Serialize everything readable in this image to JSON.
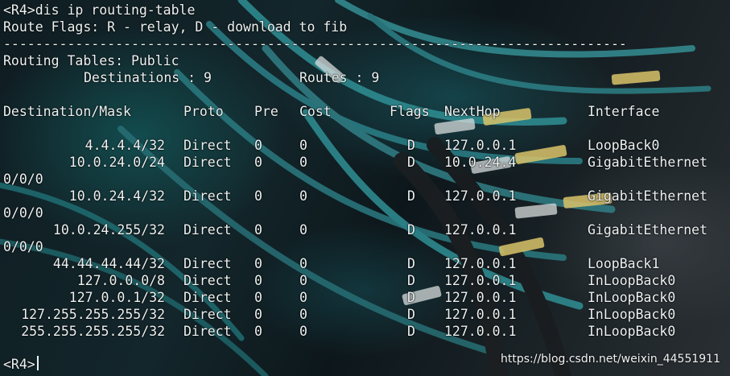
{
  "terminal": {
    "prompt_top": "<R4>dis ip routing-table",
    "flags_legend": "Route Flags: R - relay, D - download to fib",
    "separator": "------------------------------------------------------------------------------",
    "table_name": "Routing Tables: Public",
    "destinations_label": "Destinations : 9",
    "routes_label": "Routes : 9",
    "headers": {
      "dest": "Destination/Mask",
      "proto": "Proto",
      "pre": "Pre",
      "cost": "Cost",
      "flags": "Flags",
      "nexthop": "NextHop",
      "iface": "Interface"
    },
    "routes": [
      {
        "dest": "4.4.4.4/32",
        "proto": "Direct",
        "pre": "0",
        "cost": "0",
        "flags": "D",
        "nexthop": "127.0.0.1",
        "iface": "LoopBack0",
        "wrap": ""
      },
      {
        "dest": "10.0.24.0/24",
        "proto": "Direct",
        "pre": "0",
        "cost": "0",
        "flags": "D",
        "nexthop": "10.0.24.4",
        "iface": "GigabitEthernet",
        "wrap": "0/0/0"
      },
      {
        "dest": "10.0.24.4/32",
        "proto": "Direct",
        "pre": "0",
        "cost": "0",
        "flags": "D",
        "nexthop": "127.0.0.1",
        "iface": "GigabitEthernet",
        "wrap": "0/0/0"
      },
      {
        "dest": "10.0.24.255/32",
        "proto": "Direct",
        "pre": "0",
        "cost": "0",
        "flags": "D",
        "nexthop": "127.0.0.1",
        "iface": "GigabitEthernet",
        "wrap": "0/0/0"
      },
      {
        "dest": "44.44.44.44/32",
        "proto": "Direct",
        "pre": "0",
        "cost": "0",
        "flags": "D",
        "nexthop": "127.0.0.1",
        "iface": "LoopBack1",
        "wrap": ""
      },
      {
        "dest": "127.0.0.0/8",
        "proto": "Direct",
        "pre": "0",
        "cost": "0",
        "flags": "D",
        "nexthop": "127.0.0.1",
        "iface": "InLoopBack0",
        "wrap": ""
      },
      {
        "dest": "127.0.0.1/32",
        "proto": "Direct",
        "pre": "0",
        "cost": "0",
        "flags": "D",
        "nexthop": "127.0.0.1",
        "iface": "InLoopBack0",
        "wrap": ""
      },
      {
        "dest": "127.255.255.255/32",
        "proto": "Direct",
        "pre": "0",
        "cost": "0",
        "flags": "D",
        "nexthop": "127.0.0.1",
        "iface": "InLoopBack0",
        "wrap": ""
      },
      {
        "dest": "255.255.255.255/32",
        "proto": "Direct",
        "pre": "0",
        "cost": "0",
        "flags": "D",
        "nexthop": "127.0.0.1",
        "iface": "InLoopBack0",
        "wrap": ""
      }
    ],
    "prompt_bottom": "<R4>"
  },
  "watermark": "https://blog.csdn.net/weixin_44551911",
  "colors": {
    "text": "#eef2f2",
    "background": "#0b1418",
    "cable_teal": "#2f8f94",
    "cable_yellow": "#d9c36a"
  }
}
